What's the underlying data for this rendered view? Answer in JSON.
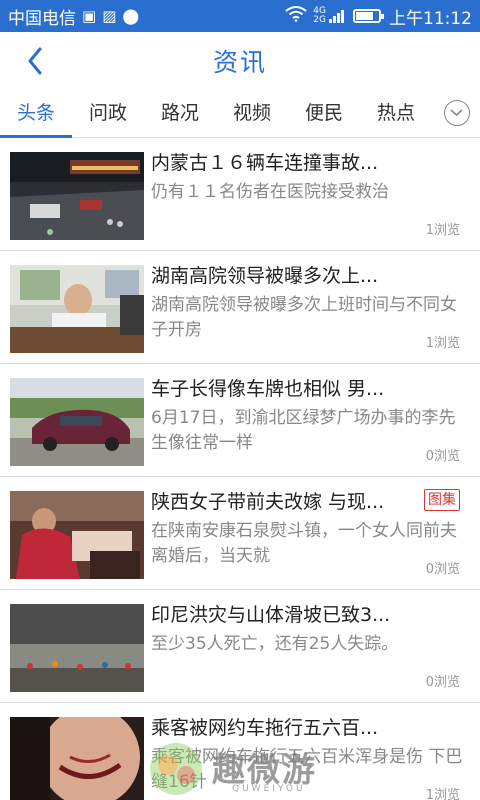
{
  "status_bar": {
    "carrier": "中国电信",
    "network_top": "4G",
    "network_bottom": "2G",
    "time": "上午11:12"
  },
  "header": {
    "title": "资讯"
  },
  "tabs": [
    {
      "label": "头条",
      "active": true
    },
    {
      "label": "问政",
      "active": false
    },
    {
      "label": "路况",
      "active": false
    },
    {
      "label": "视频",
      "active": false
    },
    {
      "label": "便民",
      "active": false
    },
    {
      "label": "热点",
      "active": false
    }
  ],
  "news": [
    {
      "headline": "内蒙古１６辆车连撞事故...",
      "summary": "仍有１１名伤者在医院接受救治",
      "views": "1浏览",
      "tag": ""
    },
    {
      "headline": "湖南高院领导被曝多次上...",
      "summary": "湖南高院领导被曝多次上班时间与不同女子开房",
      "views": "1浏览",
      "tag": ""
    },
    {
      "headline": "车子长得像车牌也相似 男...",
      "summary": "6月17日，到渝北区绿梦广场办事的李先生像往常一样",
      "views": "0浏览",
      "tag": ""
    },
    {
      "headline": "陕西女子带前夫改嫁 与现...",
      "summary": "在陕南安康石泉熨斗镇，一个女人同前夫离婚后，当天就",
      "views": "0浏览",
      "tag": "图集"
    },
    {
      "headline": "印尼洪灾与山体滑坡已致3...",
      "summary": "至少35人死亡，还有25人失踪。",
      "views": "0浏览",
      "tag": ""
    },
    {
      "headline": "乘客被网约车拖行五六百...",
      "summary": "乘客被网约车拖行五六百米浑身是伤 下巴缝16针",
      "views": "1浏览",
      "tag": ""
    }
  ],
  "watermark": {
    "text": "趣微游",
    "sub": "QUWEIYOU"
  },
  "colors": {
    "accent": "#2a6fd0",
    "tag_red": "#d33333"
  }
}
